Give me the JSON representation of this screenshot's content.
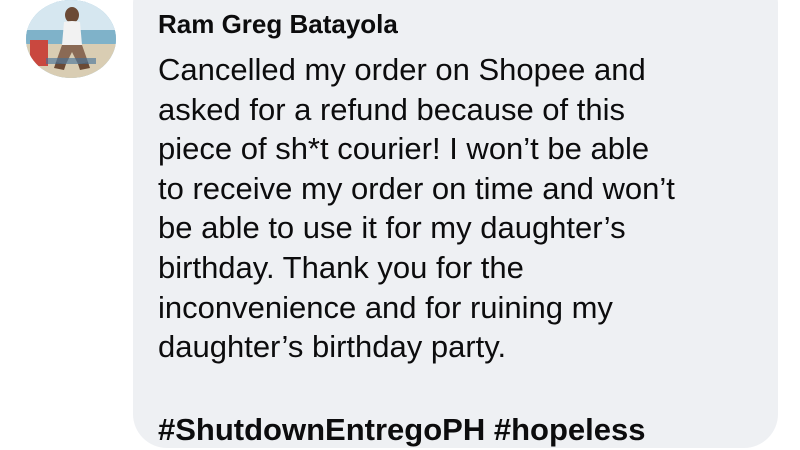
{
  "comment": {
    "author_name": "Ram Greg Batayola",
    "avatar_icon": "user-profile-photo",
    "body_lines": [
      "Cancelled my order on Shopee and",
      "asked for a refund because of this",
      "piece of sh*t courier! I won’t be able",
      "to receive my order on time and won’t",
      "be able to use it for my daughter’s",
      "birthday. Thank you for the",
      "inconvenience and for ruining my",
      "daughter’s birthday party."
    ],
    "hashtags": [
      "#ShutdownEntregoPH",
      "#hopeless"
    ]
  },
  "colors": {
    "bubble_background": "#eef0f3",
    "text": "#0c0c0d",
    "page_background": "#ffffff"
  }
}
